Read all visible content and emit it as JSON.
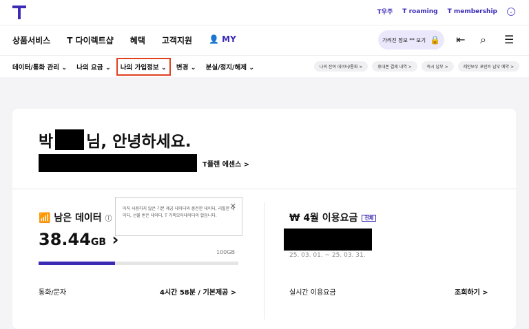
{
  "brand": {
    "logo": "T",
    "accent": "#3b2bb5"
  },
  "top_links": [
    "T우주",
    "T roaming",
    "T membership"
  ],
  "gnb": [
    "상품서비스",
    "T 다이렉트샵",
    "혜택",
    "고객지원",
    "MY"
  ],
  "hide_info_label": "가려진 정보 ** 보기",
  "subnav": [
    "데이터/통화 관리",
    "나의 요금",
    "나의 가입정보",
    "변경",
    "분실/정지/해제"
  ],
  "chips": [
    "나의 잔여 데이터/통화 >",
    "휴대폰 결제 내역 >",
    "즉시 납부 >",
    "레인보우 포인트 납부 예약 >"
  ],
  "greeting": {
    "prefix": "박",
    "suffix": "님, 안녕하세요."
  },
  "plan": "T플랜 에센스 >",
  "data": {
    "title": "남은 데이터",
    "value": "38.44",
    "unit": "GB",
    "total": "100GB",
    "remaining_fraction": 0.3844
  },
  "tooltip": "아직 사용하지 않은 기본 제공 데이터와 충전한 데이터, 리필한 데이터, 선물 받은 데이터, T 가족모아데이터의 합입니다.",
  "call": {
    "label": "통화/문자",
    "value": "4시간 58분 / 기본제공 >"
  },
  "bill": {
    "title": "₩ 4월 이용요금",
    "badge": "전체",
    "period": "25. 03. 01. ~ 25. 03. 31.",
    "realtime_label": "실시간 이용요금",
    "realtime_link": "조회하기 >"
  }
}
